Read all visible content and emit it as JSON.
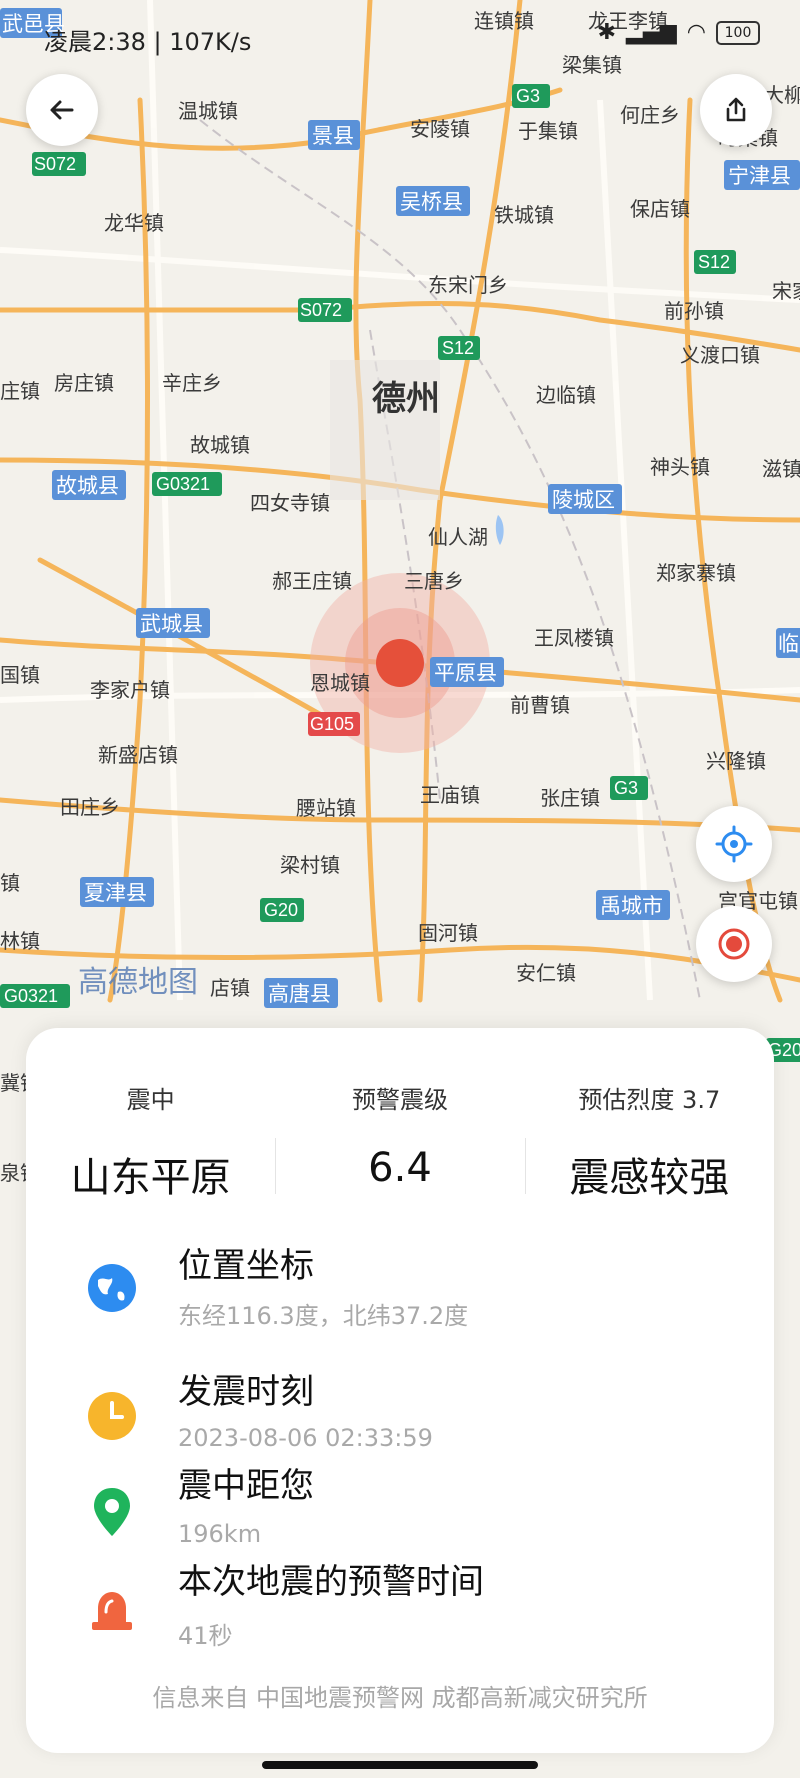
{
  "status_bar": {
    "time": "凌晨2:38 | 107K/s",
    "battery": "100"
  },
  "map": {
    "places": [
      "连镇镇",
      "龙王李镇",
      "梁集镇",
      "大柳",
      "温城镇",
      "安陵镇",
      "何庄乡",
      "于集镇",
      "时集镇",
      "龙华镇",
      "铁城镇",
      "保店镇",
      "东宋门乡",
      "前孙镇",
      "宋家",
      "房庄镇",
      "辛庄乡",
      "义渡口镇",
      "边临镇",
      "故城镇",
      "神头镇",
      "滋镇",
      "四女寺镇",
      "仙人湖",
      "郝王庄镇",
      "三唐乡",
      "郑家寨镇",
      "王凤楼镇",
      "李家户镇",
      "恩城镇",
      "前曹镇",
      "新盛店镇",
      "兴隆镇",
      "田庄乡",
      "王庙镇",
      "张庄镇",
      "腰站镇",
      "梁村镇",
      "宫官屯镇",
      "固河镇",
      "安仁镇",
      "店镇",
      "国镇",
      "镇",
      "林镇",
      "庄镇",
      "泉镇",
      "冀镇"
    ],
    "county_labels": [
      "景县",
      "吴桥县",
      "故城县",
      "陵城区",
      "武城县",
      "平原县",
      "夏津县",
      "禹城市",
      "高唐县",
      "宁津县",
      "临",
      "武邑县"
    ],
    "road_labels": [
      "G3",
      "S072",
      "S072",
      "S12",
      "S12",
      "G0321",
      "G105",
      "G20",
      "G3",
      "G0321",
      "G20"
    ],
    "city": "德州",
    "watermark": "高德地图"
  },
  "summary": {
    "epicenter_label": "震中",
    "epicenter_value": "山东平原",
    "magnitude_label": "预警震级",
    "magnitude_value": "6.4",
    "intensity_label": "预估烈度 3.7",
    "intensity_value": "震感较强"
  },
  "details": [
    {
      "icon": "globe-icon",
      "title": "位置坐标",
      "sub": "东经116.3度，北纬37.2度",
      "color": "#2d8cf0"
    },
    {
      "icon": "clock-icon",
      "title": "发震时刻",
      "sub": "2023-08-06 02:33:59",
      "color": "#f7b52c"
    },
    {
      "icon": "location-pin-icon",
      "title": "震中距您",
      "sub": "196km",
      "color": "#1fb45c"
    },
    {
      "icon": "alarm-light-icon",
      "title": "本次地震的预警时间",
      "sub": "41秒",
      "color": "#f0653f"
    }
  ],
  "footer": "信息来自 中国地震预警网 成都高新减灾研究所"
}
